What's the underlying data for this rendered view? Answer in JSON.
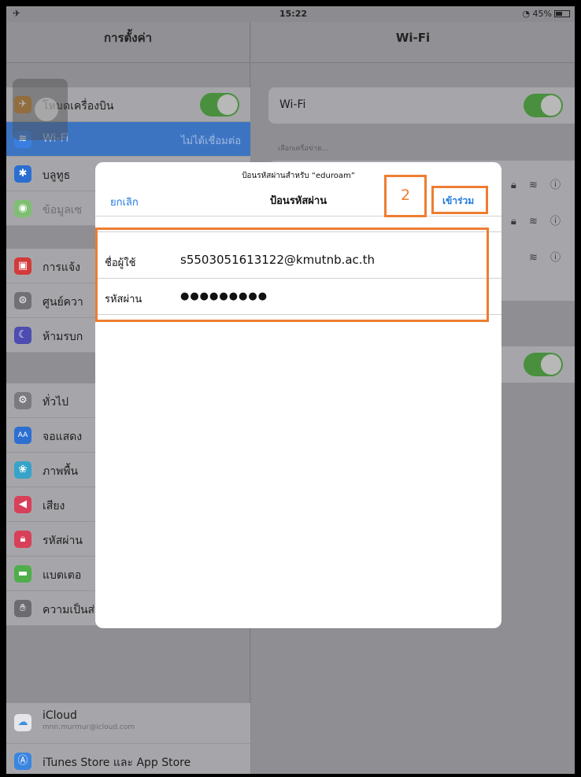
{
  "status_bar": {
    "time": "15:22",
    "battery": "45%"
  },
  "master": {
    "title": "การตั้งค่า",
    "items": [
      {
        "label": "โหมดเครื่องบิน",
        "icon": "airplane-icon"
      },
      {
        "label": "Wi-Fi",
        "value": "ไม่ได้เชื่อมต่อ",
        "icon": "wifi-icon"
      },
      {
        "label": "บลูทูธ",
        "icon": "bluetooth-icon"
      },
      {
        "label": "ข้อมูลเซ",
        "icon": "cellular-icon"
      },
      {
        "label": "การแจ้ง",
        "icon": "notifications-icon"
      },
      {
        "label": "ศูนย์ควา",
        "icon": "control-center-icon"
      },
      {
        "label": "ห้ามรบก",
        "icon": "do-not-disturb-icon"
      },
      {
        "label": "ทั่วไป",
        "icon": "general-icon"
      },
      {
        "label": "จอแสดง",
        "icon": "display-icon"
      },
      {
        "label": "ภาพพื้น",
        "icon": "wallpaper-icon"
      },
      {
        "label": "เสียง",
        "icon": "sound-icon"
      },
      {
        "label": "รหัสผ่าน",
        "icon": "passcode-icon"
      },
      {
        "label": "แบตเตอ",
        "icon": "battery-icon"
      },
      {
        "label": "ความเป็นส่วนตัว",
        "icon": "privacy-icon"
      },
      {
        "label": "iCloud",
        "sub": "mnn.murmur@icloud.com",
        "icon": "icloud-icon"
      },
      {
        "label": "iTunes Store และ App Store",
        "icon": "app-store-icon"
      }
    ]
  },
  "detail": {
    "title": "Wi-Fi",
    "wifi_label": "Wi-Fi",
    "choose_network": "เลือกเครือข่าย..."
  },
  "modal": {
    "subtitle": "ป้อนรหัสผ่านสำหรับ “eduroam”",
    "title": "ป้อนรหัสผ่าน",
    "cancel": "ยกเลิก",
    "join": "เข้าร่วม",
    "username_label": "ชื่อผู้ใช้",
    "username_value": "s5503051613122@kmutnb.ac.th",
    "password_label": "รหัสผ่าน",
    "password_value": "●●●●●●●●●"
  },
  "annotation": {
    "step": "2",
    "color": "#ed7d31"
  },
  "colors": {
    "accent": "#1e78e0",
    "toggle_on": "#4cd964",
    "selected": "#3d74c2"
  }
}
